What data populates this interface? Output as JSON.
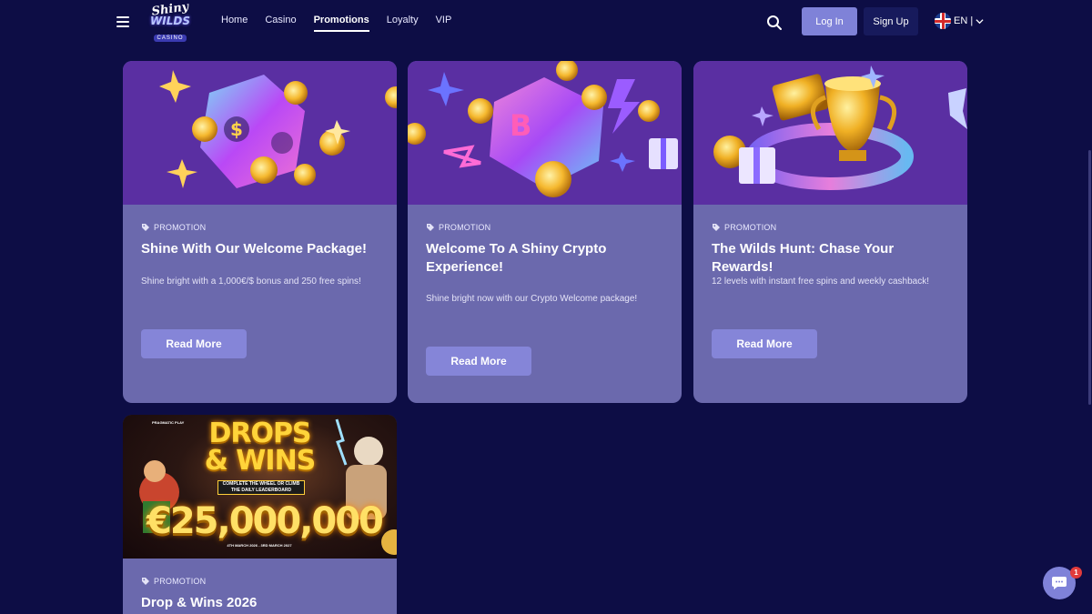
{
  "header": {
    "logo": {
      "line1": "Shiny",
      "line2": "WILDS",
      "line3": "CASINO"
    },
    "nav": [
      {
        "label": "Home",
        "active": false
      },
      {
        "label": "Casino",
        "active": false
      },
      {
        "label": "Promotions",
        "active": true
      },
      {
        "label": "Loyalty",
        "active": false
      },
      {
        "label": "VIP",
        "active": false
      }
    ],
    "login_label": "Log In",
    "signup_label": "Sign Up",
    "language": "EN |"
  },
  "promotions": [
    {
      "tag": "PROMOTION",
      "title": "Shine With Our Welcome Package!",
      "description": "Shine bright with a 1,000€/$ bonus and 250 free spins!",
      "button": "Read More",
      "image": "dice-coins-art"
    },
    {
      "tag": "PROMOTION",
      "title": "Welcome To A Shiny Crypto Experience!",
      "description": "Shine bright now with our Crypto Welcome package!",
      "button": "Read More",
      "image": "crypto-dice-art"
    },
    {
      "tag": "PROMOTION",
      "title": "The Wilds Hunt: Chase Your Rewards!",
      "description": "12 levels with instant free spins and weekly cashback!",
      "button": "Read More",
      "image": "trophy-art"
    },
    {
      "tag": "PROMOTION",
      "title": "Drop & Wins 2026",
      "image": "drops-wins-banner",
      "banner": {
        "brand": "PRAGMATIC PLAY",
        "headline": "DROPS & WINS",
        "subline": "COMPLETE THE WHEEL OR CLIMB THE DAILY LEADERBOARD",
        "amount": "€25,000,000",
        "dates": "4TH MARCH 2026 - 3RD MARCH 2027"
      }
    }
  ],
  "chat": {
    "badge": "1"
  },
  "colors": {
    "page_bg": "#0d0d45",
    "card_bg": "#6b69ad",
    "button_bg": "#8585d8",
    "art_bg": "#5a2fa2",
    "badge": "#e23b3b"
  }
}
